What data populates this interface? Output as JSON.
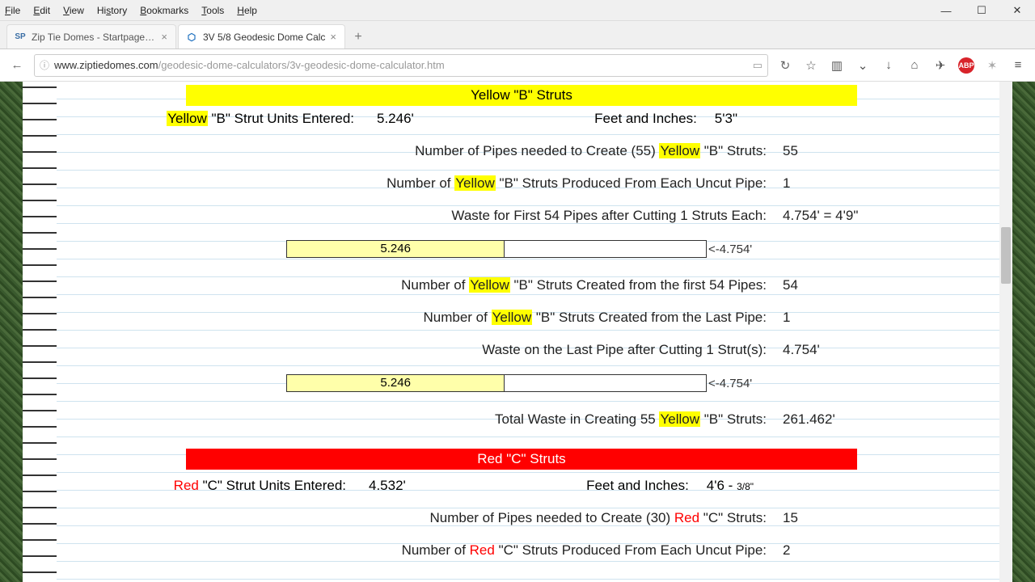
{
  "menu": {
    "file": "File",
    "edit": "Edit",
    "view": "View",
    "history": "History",
    "bookmarks": "Bookmarks",
    "tools": "Tools",
    "help": "Help"
  },
  "tabs": [
    {
      "label": "Zip Tie Domes - Startpage W",
      "active": false,
      "favicon": "SP"
    },
    {
      "label": "3V 5/8 Geodesic Dome Calc",
      "active": true,
      "favicon": "⬡"
    }
  ],
  "url": {
    "domain": "www.ziptiedomes.com",
    "path": "/geodesic-dome-calculators/3v-geodesic-dome-calculator.htm"
  },
  "yellow": {
    "header": "Yellow \"B\" Struts",
    "units_entered_label_pre": "Yellow",
    "units_entered_label_post": " \"B\" Strut Units Entered:",
    "units_entered_value": "5.246'",
    "feet_inches_label": "Feet and Inches:",
    "feet_inches_value": "5'3\"",
    "pipes_needed_pre": "Number of Pipes needed to Create (55) ",
    "pipes_needed_hl": "Yellow",
    "pipes_needed_post": " \"B\" Struts:",
    "pipes_needed_value": "55",
    "produced_pre": "Number of ",
    "produced_hl": "Yellow",
    "produced_post": " \"B\" Struts Produced From Each Uncut Pipe:",
    "produced_value": "1",
    "waste_first_label": "Waste for First 54 Pipes after Cutting 1 Struts Each:",
    "waste_first_value": "4.754' = 4'9\"",
    "bar1_seg": "5.246",
    "bar1_waste": "<-4.754'",
    "created_first_pre": "Number of ",
    "created_first_hl": "Yellow",
    "created_first_post": " \"B\" Struts Created from the first 54 Pipes:",
    "created_first_value": "54",
    "created_last_pre": "Number of ",
    "created_last_hl": "Yellow",
    "created_last_post": " \"B\" Struts Created from the Last Pipe:",
    "created_last_value": "1",
    "waste_last_label": "Waste on the Last Pipe after Cutting 1 Strut(s):",
    "waste_last_value": "4.754'",
    "bar2_seg": "5.246",
    "bar2_waste": "<-4.754'",
    "total_waste_pre": "Total Waste in Creating 55 ",
    "total_waste_hl": "Yellow",
    "total_waste_post": " \"B\" Struts:",
    "total_waste_value": "261.462'"
  },
  "red": {
    "header": "Red \"C\" Struts",
    "units_entered_label_pre": "Red",
    "units_entered_label_post": " \"C\" Strut Units Entered:",
    "units_entered_value": "4.532'",
    "feet_inches_label": "Feet and Inches:",
    "feet_inches_value_main": "4'6 - ",
    "feet_inches_value_frac": "3/8\"",
    "pipes_needed_pre": "Number of Pipes needed to Create (30) ",
    "pipes_needed_hl": "Red",
    "pipes_needed_post": " \"C\" Struts:",
    "pipes_needed_value": "15",
    "produced_pre": "Number of ",
    "produced_hl": "Red",
    "produced_post": " \"C\" Struts Produced From Each Uncut Pipe:",
    "produced_value": "2"
  }
}
